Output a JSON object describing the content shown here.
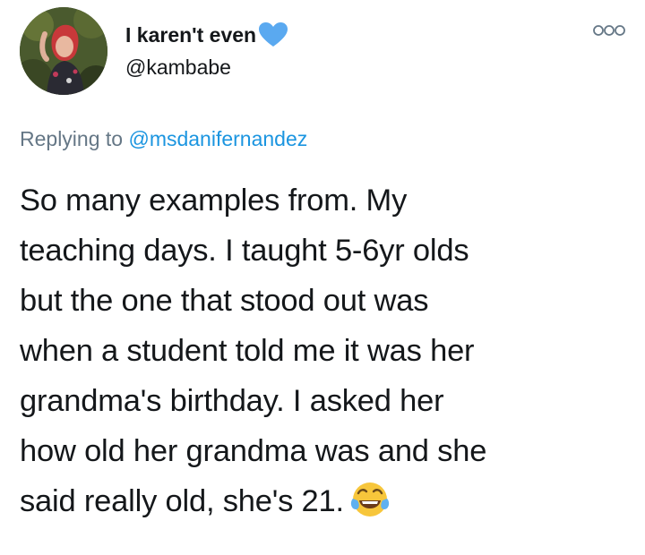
{
  "user": {
    "display_name": "I karen't even",
    "handle": "@kambabe",
    "avatar_icon": "avatar-photo",
    "name_emoji_icon": "blue-heart-icon"
  },
  "menu": {
    "more_icon": "more-dots-icon"
  },
  "reply": {
    "prefix": "Replying to",
    "mention": "@msdanifernandez"
  },
  "tweet": {
    "lines": [
      "So many examples from. My",
      "teaching days. I taught 5-6yr olds",
      "but the one that stood out was",
      "when a student told me it was her",
      "grandma's birthday. I asked her",
      "how old her grandma was and she",
      "said really old, she's 21."
    ],
    "trailing_emoji_icon": "tears-of-joy-icon"
  },
  "colors": {
    "text": "#14171a",
    "secondary": "#657786",
    "link": "#1b95e0",
    "heart": "#5aa9f0"
  }
}
